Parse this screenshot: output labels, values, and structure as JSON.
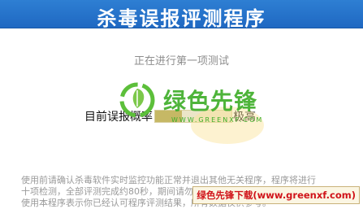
{
  "window": {
    "title": "杀毒误报评测程序"
  },
  "status": {
    "step_text": "正在进行第一项测试"
  },
  "result": {
    "label": "目前误报概率",
    "value": "极高",
    "bar_fraction": 0.35
  },
  "description": {
    "line1": "使用前请确认杀毒软件实时监控功能正常并退出其他无关程序，程序将进行",
    "line2": "十项检测，全部评测完成约80秒，期间请勿执行其他操作。",
    "line3": "使用本程序表示你已经认可程序评测结果，所有数据仅供参考。"
  },
  "watermark": {
    "brand": "绿色先锋",
    "url": "WWW.GREENXF.COM"
  },
  "badge": {
    "text": "绿色先锋下载(www.greenxf.com)"
  },
  "colors": {
    "title_bar": "#2478cc",
    "brand_green": "#3fae2a",
    "badge_text": "#d0141a"
  }
}
